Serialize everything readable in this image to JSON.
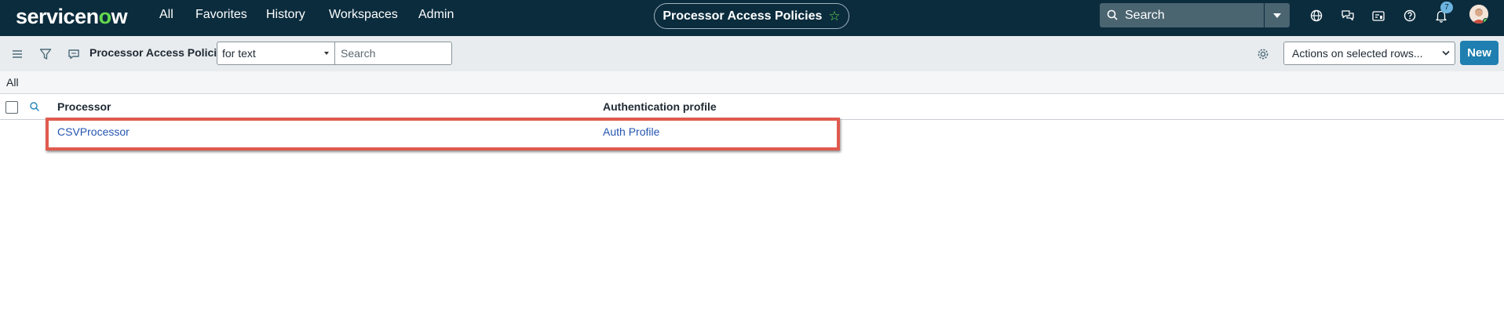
{
  "topnav": {
    "logo_left": "servicen",
    "logo_o": "o",
    "logo_right": "w",
    "links": [
      "All",
      "Favorites",
      "History",
      "Workspaces",
      "Admin"
    ],
    "page_title": "Processor Access Policies",
    "search_placeholder": "Search",
    "notification_count": "7",
    "icons": [
      "globe-icon",
      "chat-icon",
      "inbox-icon",
      "help-icon",
      "bell-icon",
      "avatar"
    ]
  },
  "toolbar": {
    "list_title": "Processor Access Policies",
    "field_select": "for text",
    "search_placeholder": "Search",
    "actions_select": "Actions on selected rows...",
    "new_label": "New"
  },
  "breadcrumb": {
    "label": "All"
  },
  "table": {
    "columns": [
      "Processor",
      "Authentication profile"
    ],
    "rows": [
      {
        "processor": "CSVProcessor",
        "auth_profile": "Auth Profile"
      }
    ]
  },
  "colors": {
    "nav_bg": "#0b2c3d",
    "accent_green": "#62d84e",
    "primary_button": "#1e7fb0",
    "link": "#2555b0",
    "highlight": "#e05a4e"
  }
}
